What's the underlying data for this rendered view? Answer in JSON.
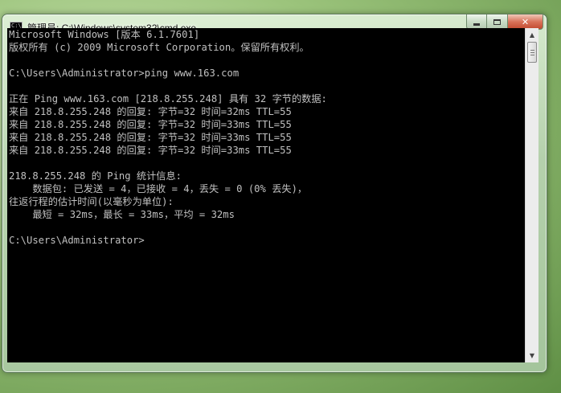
{
  "window": {
    "title": "管理员: C:\\Windows\\system32\\cmd.exe",
    "icon": "cmd-icon",
    "icon_prompt": "C:\\",
    "buttons": {
      "minimize_icon": "minimize-icon",
      "maximize_icon": "maximize-icon",
      "close_label": "✕"
    }
  },
  "console": {
    "lines": [
      "Microsoft Windows [版本 6.1.7601]",
      "版权所有 (c) 2009 Microsoft Corporation。保留所有权利。",
      "",
      "C:\\Users\\Administrator>ping www.163.com",
      "",
      "正在 Ping www.163.com [218.8.255.248] 具有 32 字节的数据:",
      "来自 218.8.255.248 的回复: 字节=32 时间=32ms TTL=55",
      "来自 218.8.255.248 的回复: 字节=32 时间=33ms TTL=55",
      "来自 218.8.255.248 的回复: 字节=32 时间=33ms TTL=55",
      "来自 218.8.255.248 的回复: 字节=32 时间=33ms TTL=55",
      "",
      "218.8.255.248 的 Ping 统计信息:",
      "    数据包: 已发送 = 4，已接收 = 4，丢失 = 0 (0% 丢失)，",
      "往返行程的估计时间(以毫秒为单位):",
      "    最短 = 32ms，最长 = 33ms，平均 = 32ms",
      "",
      "C:\\Users\\Administrator>"
    ]
  },
  "scrollbar": {
    "up_glyph": "▲",
    "down_glyph": "▼"
  },
  "colors": {
    "console_bg": "#000000",
    "console_fg": "#c0c0c0",
    "close_button": "#c24a30"
  }
}
